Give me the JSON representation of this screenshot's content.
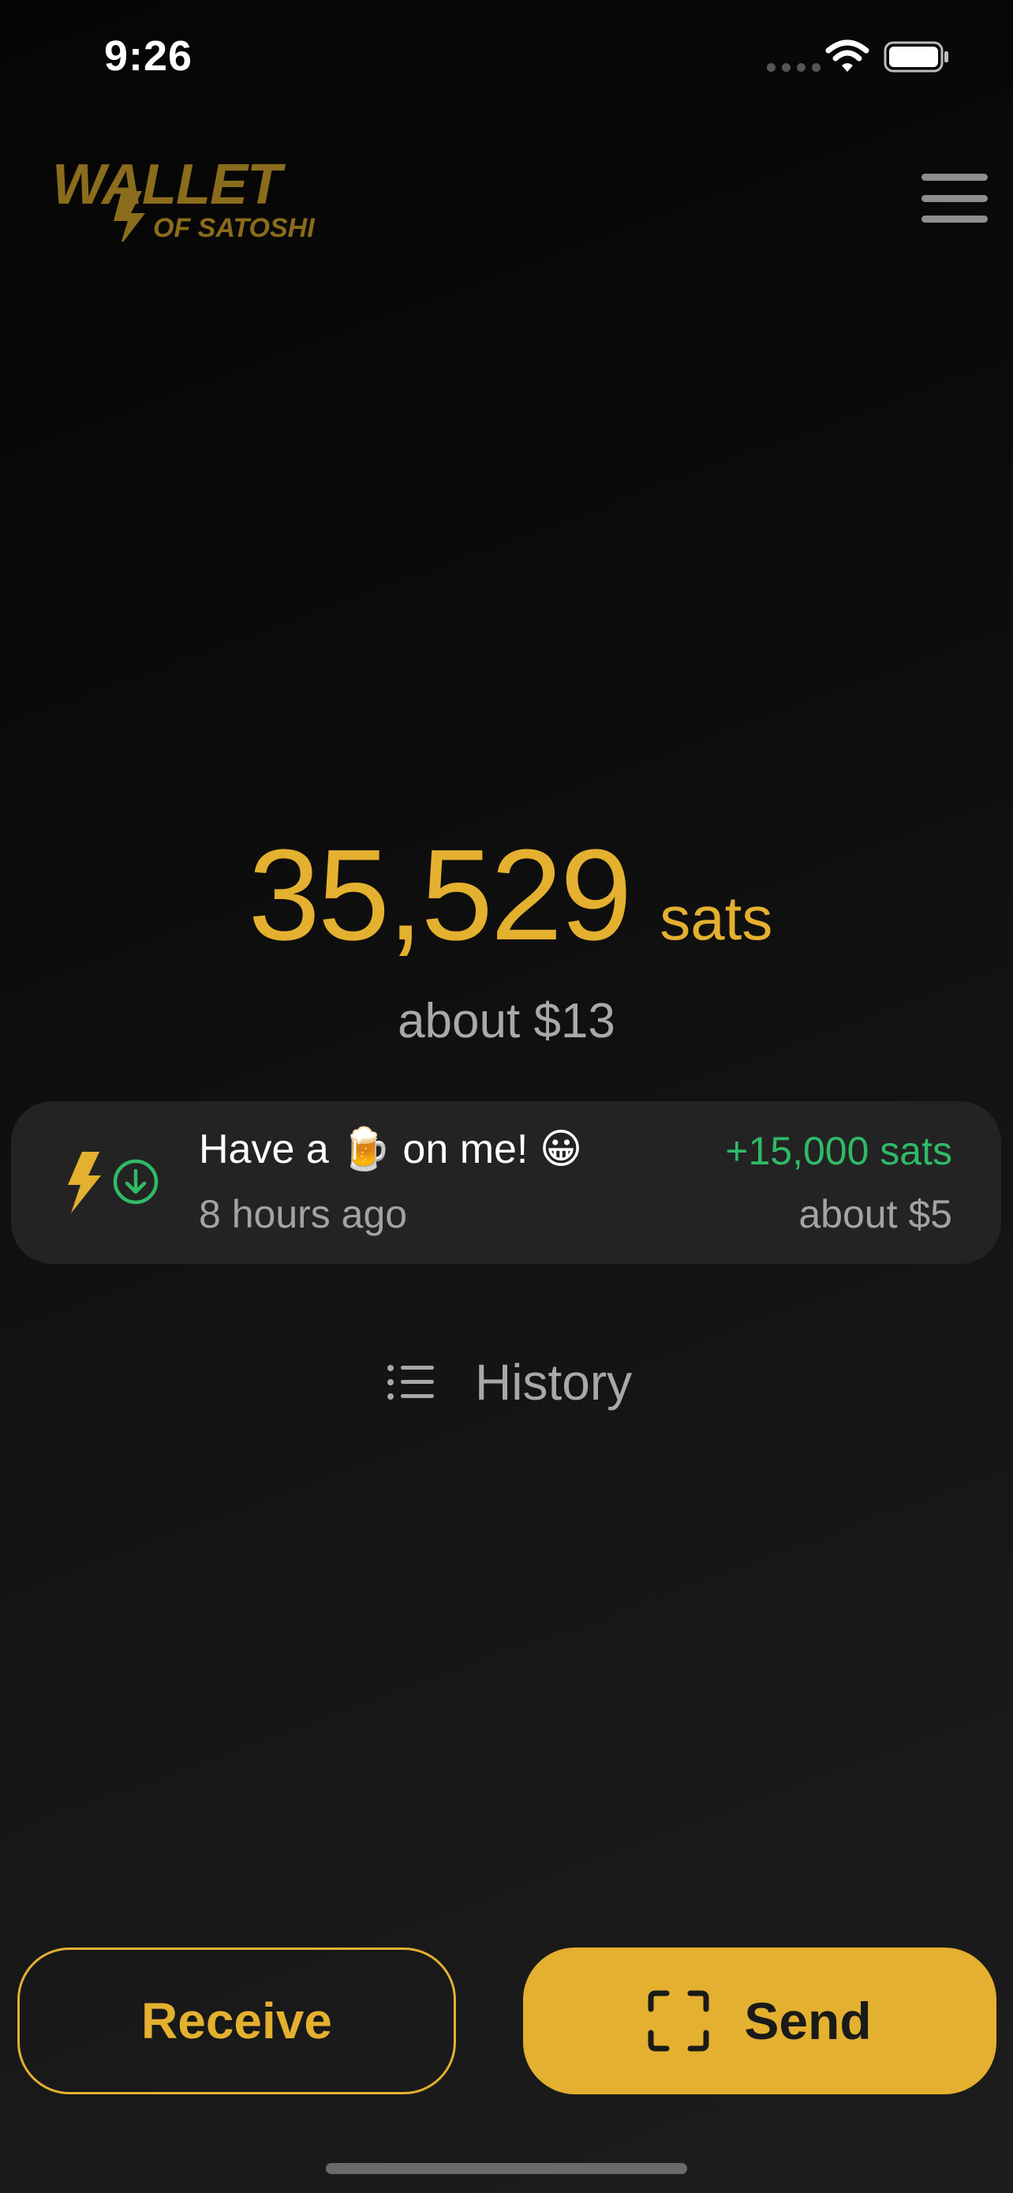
{
  "status_bar": {
    "time": "9:26"
  },
  "header": {
    "logo_text_main": "WALLET",
    "logo_text_sub": "OF SATOSHI",
    "menu_icon": "hamburger-menu-icon"
  },
  "balance": {
    "amount": "35,529",
    "unit": "sats",
    "fiat": "about $13"
  },
  "latest_transaction": {
    "network_icon": "lightning-bolt-icon",
    "direction_icon": "arrow-down-circle-icon",
    "memo": "Have a 🍺 on me! 😀",
    "time": "8 hours ago",
    "amount": "+15,000 sats",
    "fiat": "about $5",
    "amount_color": "#2fba67"
  },
  "history": {
    "label": "History",
    "icon": "list-icon"
  },
  "actions": {
    "receive_label": "Receive",
    "send_label": "Send",
    "send_icon": "scan-qr-icon"
  },
  "colors": {
    "accent": "#e4b02f",
    "background": "#0c0c0c",
    "card": "#232323",
    "positive": "#2fba67"
  }
}
